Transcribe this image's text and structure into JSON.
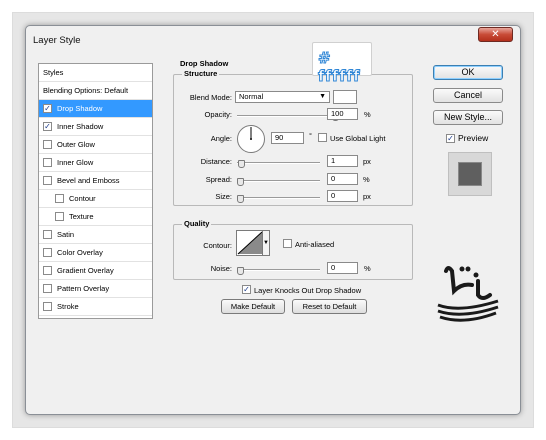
{
  "dialog": {
    "title": "Layer Style",
    "close_glyph": "✕"
  },
  "styles_list": {
    "header": "Styles",
    "blending": "Blending Options: Default",
    "items": [
      {
        "label": "Drop Shadow",
        "checked": true,
        "selected": true
      },
      {
        "label": "Inner Shadow",
        "checked": true
      },
      {
        "label": "Outer Glow",
        "checked": false
      },
      {
        "label": "Inner Glow",
        "checked": false
      },
      {
        "label": "Bevel and Emboss",
        "checked": false
      },
      {
        "label": "Contour",
        "checked": false,
        "sub": true
      },
      {
        "label": "Texture",
        "checked": false,
        "sub": true
      },
      {
        "label": "Satin",
        "checked": false
      },
      {
        "label": "Color Overlay",
        "checked": false
      },
      {
        "label": "Gradient Overlay",
        "checked": false
      },
      {
        "label": "Pattern Overlay",
        "checked": false
      },
      {
        "label": "Stroke",
        "checked": false
      }
    ]
  },
  "drop_shadow": {
    "section_title": "Drop Shadow",
    "structure_title": "Structure",
    "blend_mode_label": "Blend Mode:",
    "blend_mode_value": "Normal",
    "shadow_color": "#ffffff",
    "opacity_label": "Opacity:",
    "opacity_value": "100",
    "opacity_unit": "%",
    "angle_label": "Angle:",
    "angle_value": "90",
    "angle_unit": "°",
    "global_light_label": "Use Global Light",
    "distance_label": "Distance:",
    "distance_value": "1",
    "distance_unit": "px",
    "spread_label": "Spread:",
    "spread_value": "0",
    "spread_unit": "%",
    "size_label": "Size:",
    "size_value": "0",
    "size_unit": "px",
    "quality_title": "Quality",
    "contour_label": "Contour:",
    "anti_aliased_label": "Anti-aliased",
    "noise_label": "Noise:",
    "noise_value": "0",
    "noise_unit": "%",
    "knocks_out_label": "Layer Knocks Out Drop Shadow",
    "make_default": "Make Default",
    "reset_default": "Reset to Default"
  },
  "right_buttons": {
    "ok": "OK",
    "cancel": "Cancel",
    "new_style": "New Style...",
    "preview": "Preview"
  },
  "badge": {
    "text": "# ffffff",
    "color": "#2f86d6"
  },
  "watermark": {
    "text": "تیـک وب",
    "color": "#1a1a1a"
  }
}
